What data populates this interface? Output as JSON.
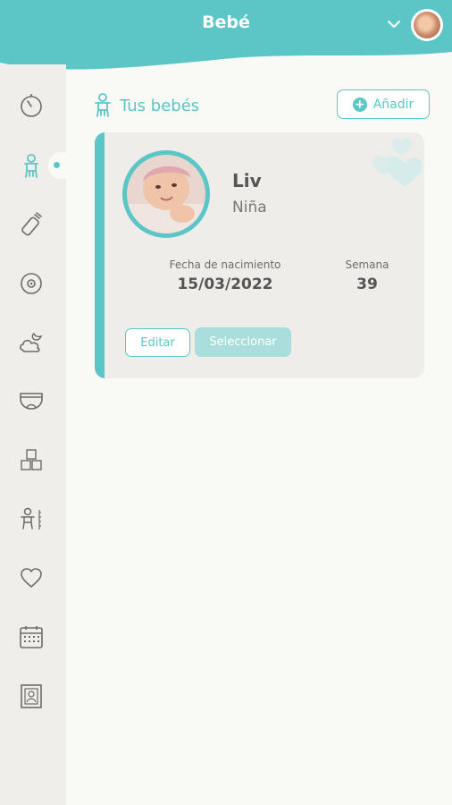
{
  "header": {
    "title": "Bebé",
    "dropdown_icon": "chevron-down-icon",
    "avatar": "baby-avatar"
  },
  "colors": {
    "accent": "#5cc6c6",
    "accent_light": "#a9dedd",
    "sidebar_bg": "#efeeea",
    "page_bg": "#f9f9f6",
    "card_bg": "#eeede9"
  },
  "sidebar": {
    "items": [
      {
        "icon": "timer-icon",
        "active": false
      },
      {
        "icon": "baby-icon",
        "active": true
      },
      {
        "icon": "bottle-icon",
        "active": false
      },
      {
        "icon": "breast-icon",
        "active": false
      },
      {
        "icon": "sleep-icon",
        "active": false
      },
      {
        "icon": "diaper-icon",
        "active": false
      },
      {
        "icon": "blocks-icon",
        "active": false
      },
      {
        "icon": "growth-icon",
        "active": false
      },
      {
        "icon": "heart-icon",
        "active": false
      },
      {
        "icon": "calendar-icon",
        "active": false
      },
      {
        "icon": "photo-frame-icon",
        "active": false
      }
    ]
  },
  "main": {
    "section_title": "Tus bebés",
    "add_label": "Añadir",
    "babies": [
      {
        "name": "Liv",
        "gender": "Niña",
        "birth_label": "Fecha de nacimiento",
        "birth_date": "15/03/2022",
        "week_label": "Semana",
        "week": "39",
        "edit_label": "Editar",
        "select_label": "Seleccionar"
      }
    ]
  }
}
